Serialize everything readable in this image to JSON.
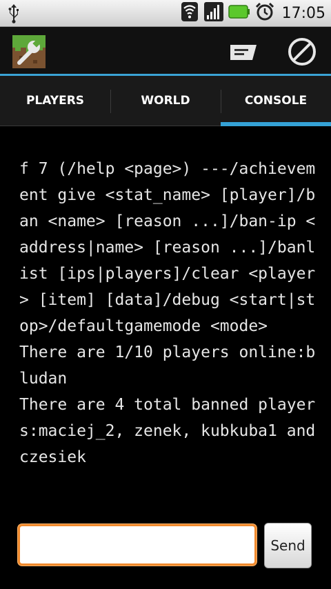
{
  "status_bar": {
    "time": "17:05",
    "icons": [
      "usb-icon",
      "wifi-icon",
      "signal-icon",
      "battery-icon",
      "alarm-icon"
    ]
  },
  "action_bar": {
    "app_icon": "minecraft-grass-wrench-icon",
    "actions": [
      "message-icon",
      "block-icon"
    ]
  },
  "tabs": [
    {
      "label": "PLAYERS",
      "active": false
    },
    {
      "label": "WORLD",
      "active": false
    },
    {
      "label": "CONSOLE",
      "active": true
    }
  ],
  "console": {
    "lines": [
      "f 7 (/help <page>) ---/achievement give <stat_name> [player]/ban <name> [reason ...]/ban-ip <address|name> [reason ...]/banlist [ips|players]/clear <player> [item] [data]/debug <start|stop>/defaultgamemode <mode>",
      "There are 1/10 players online:bludan",
      "There are 4 total banned players:maciej_2, zenek, kubkuba1 and czesiek"
    ]
  },
  "command": {
    "value": "",
    "send_label": "Send"
  },
  "colors": {
    "accent": "#35a2d6",
    "input_focus": "#f08a2e"
  }
}
